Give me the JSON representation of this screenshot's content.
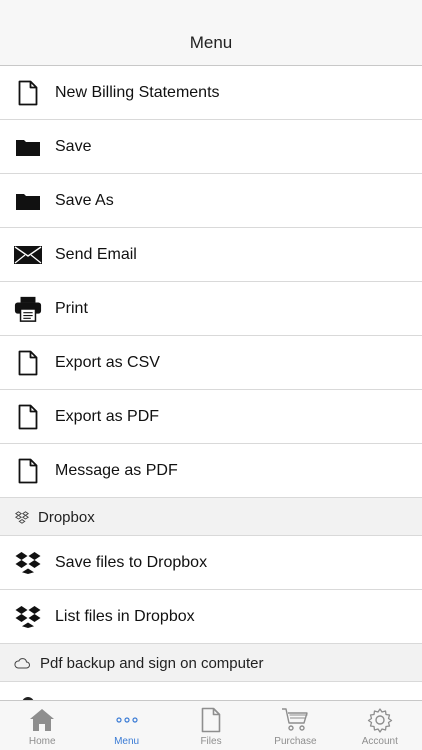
{
  "header": {
    "title": "Menu"
  },
  "menu_items": [
    {
      "label": "New Billing Statements",
      "icon": "document-icon"
    },
    {
      "label": "Save",
      "icon": "folder-icon"
    },
    {
      "label": "Save As",
      "icon": "folder-icon"
    },
    {
      "label": "Send Email",
      "icon": "envelope-icon"
    },
    {
      "label": "Print",
      "icon": "printer-icon"
    },
    {
      "label": "Export as CSV",
      "icon": "document-icon"
    },
    {
      "label": "Export as PDF",
      "icon": "document-icon"
    },
    {
      "label": "Message as PDF",
      "icon": "document-icon"
    }
  ],
  "dropbox_section": {
    "title": "Dropbox",
    "icon": "dropbox-outline-icon",
    "items": [
      {
        "label": "Save files to Dropbox",
        "icon": "dropbox-icon"
      },
      {
        "label": "List files in Dropbox",
        "icon": "dropbox-icon"
      }
    ]
  },
  "cloud_section": {
    "title": "Pdf backup and sign on computer",
    "icon": "cloud-icon"
  },
  "tabbar": {
    "active": "Menu",
    "tabs": [
      {
        "label": "Home",
        "icon": "home-icon"
      },
      {
        "label": "Menu",
        "icon": "more-dots-icon"
      },
      {
        "label": "Files",
        "icon": "file-icon"
      },
      {
        "label": "Purchase",
        "icon": "cart-icon"
      },
      {
        "label": "Account",
        "icon": "gear-icon"
      }
    ]
  },
  "colors": {
    "accent": "#3a7bd5",
    "inactive": "#8e8e8e",
    "section_bg": "#f2f2f2"
  }
}
